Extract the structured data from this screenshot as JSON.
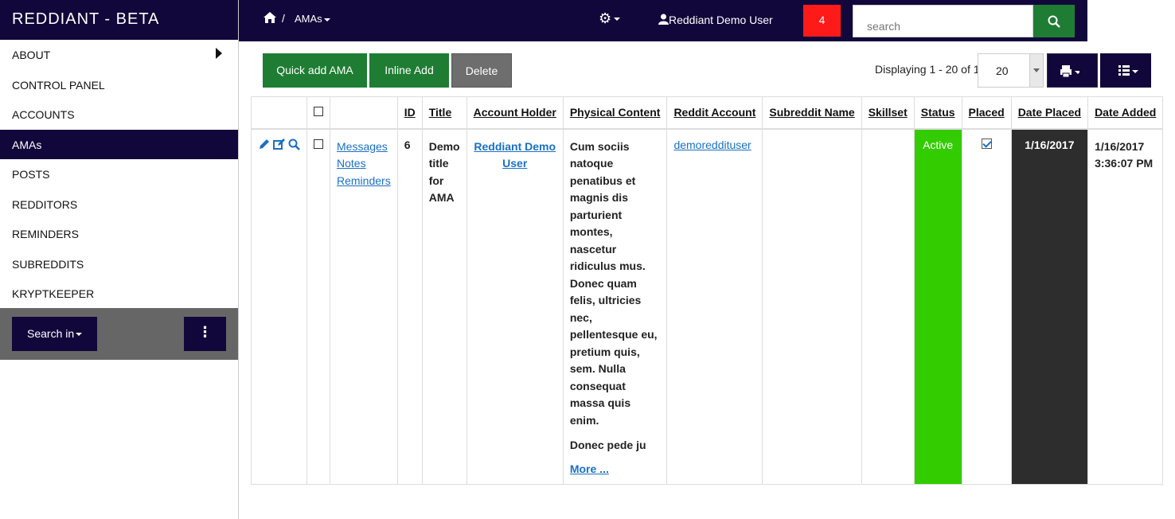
{
  "sidebar": {
    "brand": "REDDIANT - BETA",
    "items": [
      {
        "label": "ABOUT"
      },
      {
        "label": "CONTROL PANEL"
      },
      {
        "label": "ACCOUNTS"
      },
      {
        "label": "AMAs"
      },
      {
        "label": "POSTS"
      },
      {
        "label": "REDDITORS"
      },
      {
        "label": "REMINDERS"
      },
      {
        "label": "SUBREDDITS"
      },
      {
        "label": "KRYPTKEEPER"
      }
    ],
    "search_in_label": "Search in",
    "kebab": "⋮"
  },
  "topbar": {
    "breadcrumb_sep": "/",
    "breadcrumb_current": "AMAs",
    "user_name": "Reddiant Demo User",
    "notification_count": "4",
    "search_placeholder": "search"
  },
  "toolbar": {
    "quick_add": "Quick add AMA",
    "inline_add": "Inline Add",
    "delete": "Delete",
    "displaying": "Displaying 1 - 20 of 1",
    "page_size": "20"
  },
  "table": {
    "headers": [
      "ID",
      "Title",
      "Account Holder",
      "Physical Content",
      "Reddit Account",
      "Subreddit Name",
      "Skillset",
      "Status",
      "Placed",
      "Date Placed",
      "Date Added"
    ],
    "row": {
      "links": [
        "Messages",
        "Notes",
        "Reminders"
      ],
      "id": "6",
      "title": "Demo title for AMA",
      "account_holder": "Reddiant Demo User",
      "physical_content": "Cum sociis natoque penatibus et magnis dis parturient montes, nascetur ridiculus mus. Donec quam felis, ultricies nec, pellentesque eu, pretium quis, sem. Nulla consequat massa quis enim.",
      "physical_content_2": "Donec pede ju",
      "more": "More ...",
      "reddit_account": "demoreddituser",
      "subreddit_name": "",
      "skillset": "",
      "status": "Active",
      "date_placed": "1/16/2017",
      "date_added": "1/16/2017 3:36:07 PM"
    }
  },
  "colors": {
    "navy": "#12073a",
    "green": "#1e7d33",
    "status_active": "#33cc00",
    "notification": "#ff1a1a",
    "link": "#1a70c4"
  }
}
